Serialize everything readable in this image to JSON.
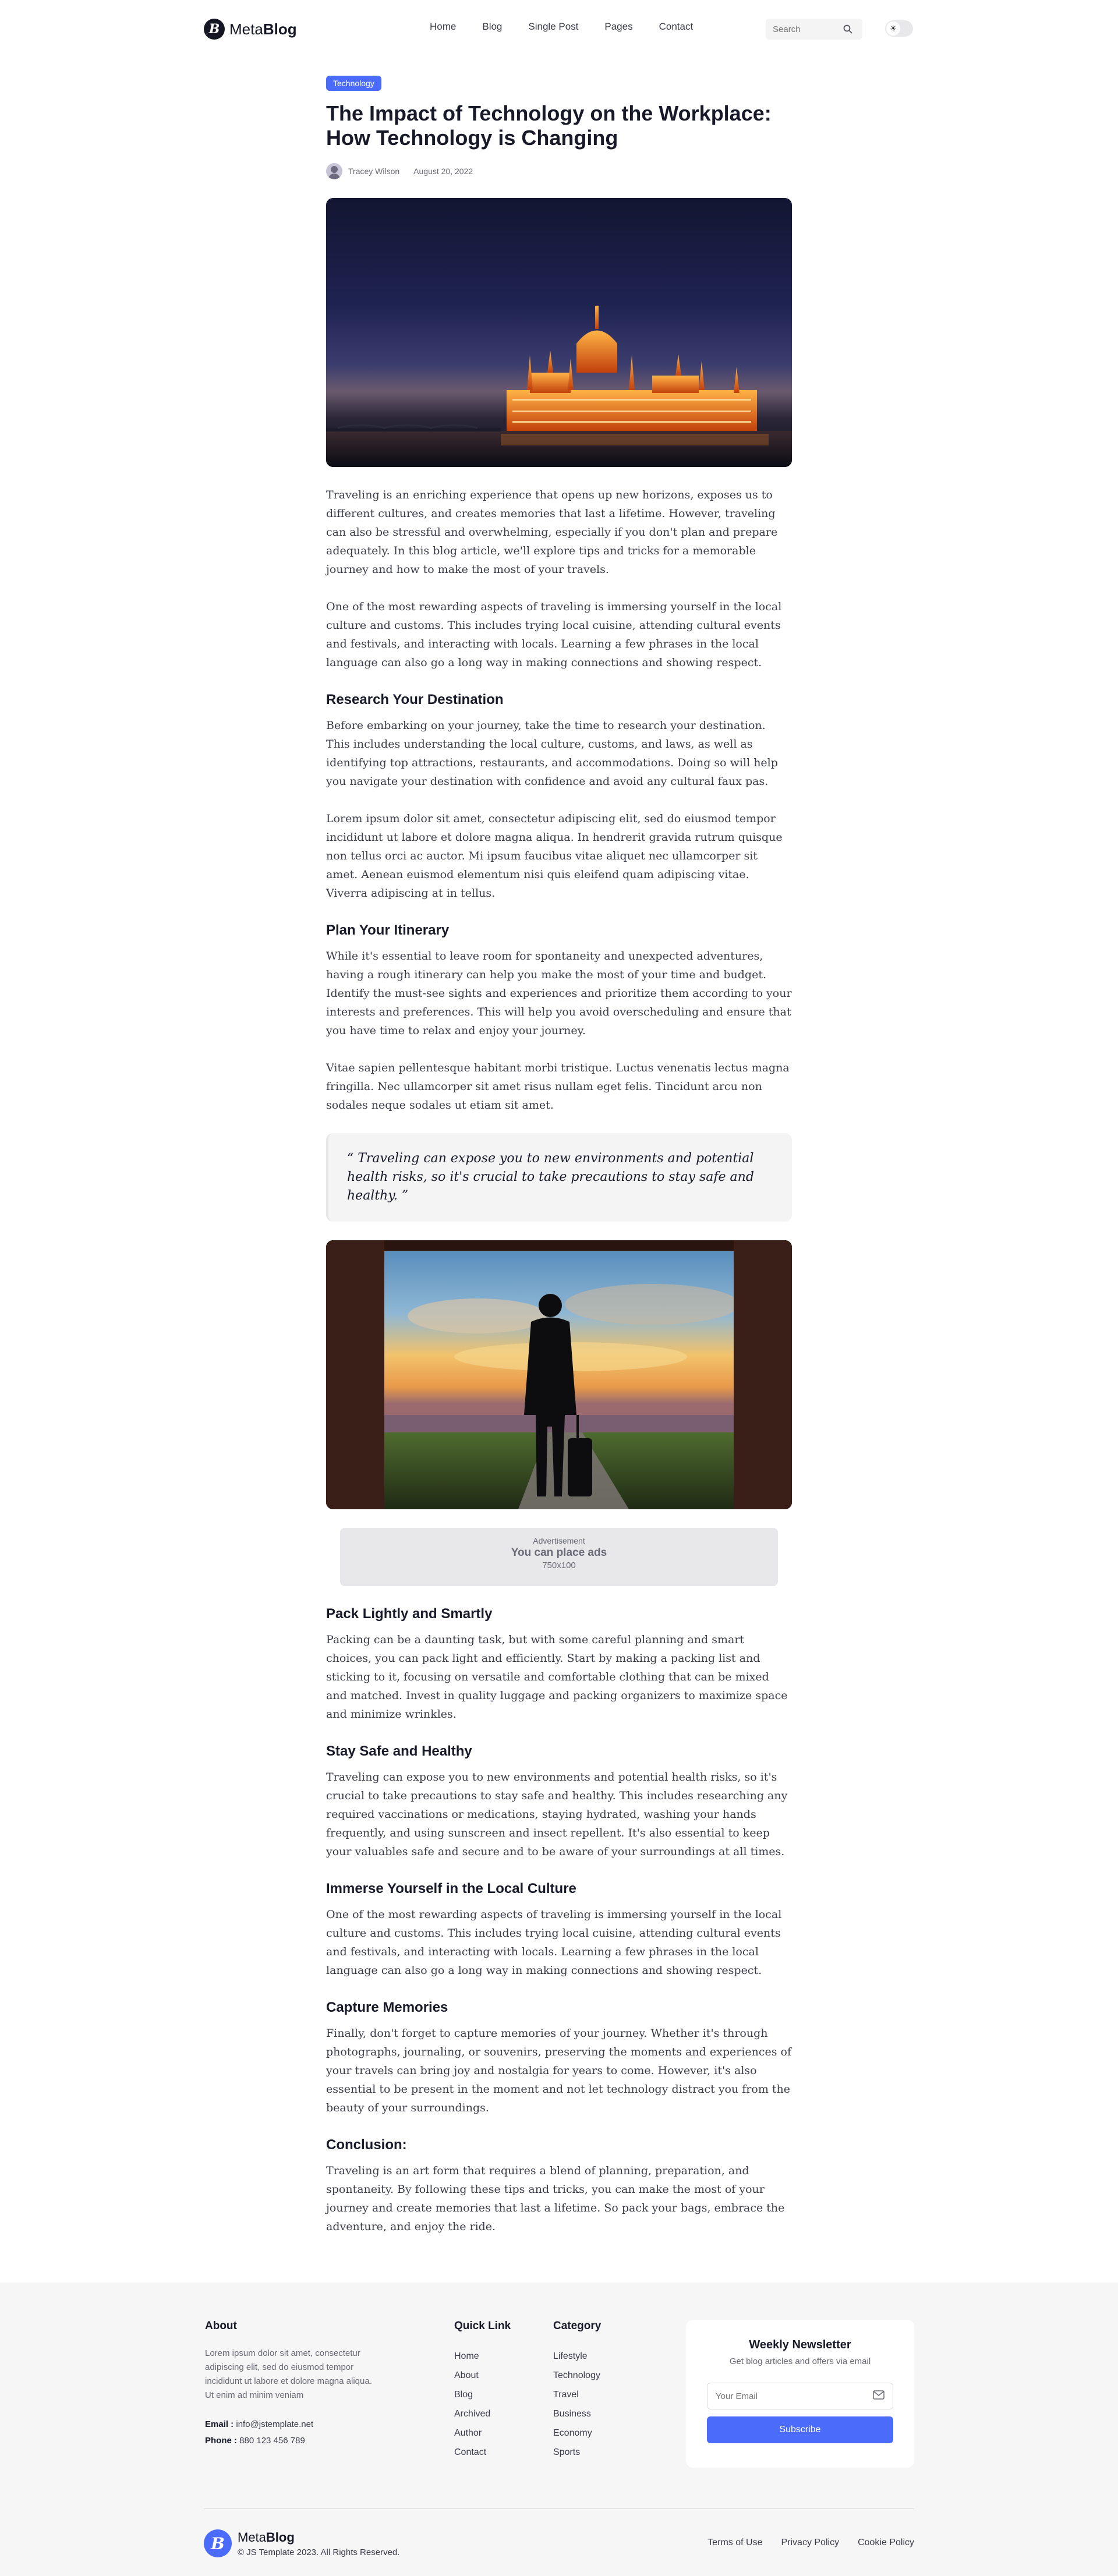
{
  "header": {
    "brand_light": "Meta",
    "brand_bold": "Blog",
    "nav": [
      "Home",
      "Blog",
      "Single Post",
      "Pages",
      "Contact"
    ],
    "search_placeholder": "Search",
    "toggle_icon": "☀"
  },
  "article": {
    "category": "Technology",
    "title": "The Impact of Technology on the Workplace: How Technology is Changing",
    "author": "Tracey Wilson",
    "date": "August 20, 2022",
    "intro_1": "Traveling is an enriching experience that opens up new horizons, exposes us to different cultures, and creates memories that last a lifetime. However, traveling can also be stressful and overwhelming, especially if you don't plan and prepare adequately. In this blog article, we'll explore tips and tricks for a memorable journey and how to make the most of your travels.",
    "intro_2": "One of the most rewarding aspects of traveling is immersing yourself in the local culture and customs. This includes trying local cuisine, attending cultural events and festivals, and interacting with locals. Learning a few phrases in the local language can also go a long way in making connections and showing respect.",
    "s1_heading": "Research Your Destination",
    "s1_p1": "Before embarking on your journey, take the time to research your destination. This includes understanding the local culture, customs, and laws, as well as identifying top attractions, restaurants, and accommodations. Doing so will help you navigate your destination with confidence and avoid any cultural faux pas.",
    "s1_p2": "Lorem ipsum dolor sit amet, consectetur adipiscing elit, sed do eiusmod tempor incididunt ut labore et dolore magna aliqua. In hendrerit gravida rutrum quisque non tellus orci ac auctor. Mi ipsum faucibus vitae aliquet nec ullamcorper sit amet. Aenean euismod elementum nisi quis eleifend quam adipiscing vitae. Viverra adipiscing at in tellus.",
    "s2_heading": "Plan Your Itinerary",
    "s2_p1": "While it's essential to leave room for spontaneity and unexpected adventures, having a rough itinerary can help you make the most of your time and budget. Identify the must-see sights and experiences and prioritize them according to your interests and preferences. This will help you avoid overscheduling and ensure that you have time to relax and enjoy your journey.",
    "s2_p2": "Vitae sapien pellentesque habitant morbi tristique. Luctus venenatis lectus magna fringilla. Nec ullamcorper sit amet risus nullam eget felis. Tincidunt arcu non sodales neque sodales ut etiam sit amet.",
    "quote": "“ Traveling can expose you to new environments and potential health risks, so it's crucial to take precautions to stay safe and healthy. ”",
    "ad": {
      "label": "Advertisement",
      "main": "You can place ads",
      "size": "750x100"
    },
    "s3_heading": "Pack Lightly and Smartly",
    "s3_p1": "Packing can be a daunting task, but with some careful planning and smart choices, you can pack light and efficiently. Start by making a packing list and sticking to it, focusing on versatile and comfortable clothing that can be mixed and matched. Invest in quality luggage and packing organizers to maximize space and minimize wrinkles.",
    "s4_heading": "Stay Safe and Healthy",
    "s4_p1": "Traveling can expose you to new environments and potential health risks, so it's crucial to take precautions to stay safe and healthy. This includes researching any required vaccinations or medications, staying hydrated, washing your hands frequently, and using sunscreen and insect repellent. It's also essential to keep your valuables safe and secure and to be aware of your surroundings at all times.",
    "s5_heading": "Immerse Yourself in the Local Culture",
    "s5_p1": "One of the most rewarding aspects of traveling is immersing yourself in the local culture and customs. This includes trying local cuisine, attending cultural events and festivals, and interacting with locals. Learning a few phrases in the local language can also go a long way in making connections and showing respect.",
    "s6_heading": "Capture Memories",
    "s6_p1": "Finally, don't forget to capture memories of your journey. Whether it's through photographs, journaling, or souvenirs, preserving the moments and experiences of your travels can bring joy and nostalgia for years to come. However, it's also essential to be present in the moment and not let technology distract you from the beauty of your surroundings.",
    "s7_heading": "Conclusion:",
    "s7_p1": "Traveling is an art form that requires a blend of planning, preparation, and spontaneity. By following these tips and tricks, you can make the most of your journey and create memories that last a lifetime. So pack your bags, embrace the adventure, and enjoy the ride."
  },
  "footer": {
    "about_heading": "About",
    "about_text": "Lorem ipsum dolor sit amet, consectetur adipiscing elit, sed do eiusmod tempor incididunt ut labore et dolore magna aliqua. Ut enim ad minim veniam",
    "email_label": "Email :",
    "email_value": "info@jstemplate.net",
    "phone_label": "Phone :",
    "phone_value": "880 123 456 789",
    "quick_heading": "Quick Link",
    "quick_links": [
      "Home",
      "About",
      "Blog",
      "Archived",
      "Author",
      "Contact"
    ],
    "category_heading": "Category",
    "categories": [
      "Lifestyle",
      "Technology",
      "Travel",
      "Business",
      "Economy",
      "Sports"
    ],
    "newsletter": {
      "title": "Weekly Newsletter",
      "subtitle": "Get blog articles and offers via email",
      "placeholder": "Your Email",
      "button": "Subscribe"
    },
    "brand_light": "Meta",
    "brand_bold": "Blog",
    "copyright": "© JS Template 2023. All Rights Reserved.",
    "legal": [
      "Terms of Use",
      "Privacy Policy",
      "Cookie Policy"
    ]
  }
}
